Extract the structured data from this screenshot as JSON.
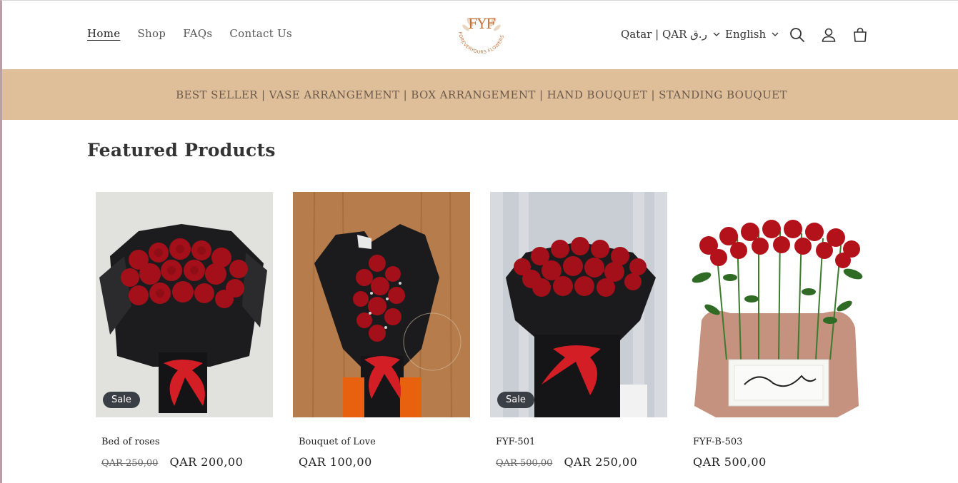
{
  "header": {
    "nav": [
      {
        "label": "Home",
        "active": true
      },
      {
        "label": "Shop",
        "active": false
      },
      {
        "label": "FAQs",
        "active": false
      },
      {
        "label": "Contact Us",
        "active": false
      }
    ],
    "logo_monogram": "FYF",
    "logo_text": "FOREVERYOURS FLOWERS",
    "country_currency": "Qatar | QAR ر.ق",
    "language": "English",
    "icons": [
      "search-icon",
      "account-icon",
      "cart-icon"
    ]
  },
  "banner": {
    "text": "BEST SELLER | VASE ARRANGEMENT | BOX ARRANGEMENT | HAND BOUQUET | STANDING BOUQUET"
  },
  "featured": {
    "title": "Featured Products",
    "products": [
      {
        "name": "Bed of roses",
        "old_price": "QAR 250,00",
        "price": "QAR 200,00",
        "badge": "Sale"
      },
      {
        "name": "Bouquet of Love",
        "old_price": "",
        "price": "QAR 100,00",
        "badge": ""
      },
      {
        "name": "FYF-501",
        "old_price": "QAR 500,00",
        "price": "QAR 250,00",
        "badge": "Sale"
      },
      {
        "name": "FYF-B-503",
        "old_price": "",
        "price": "QAR 500,00",
        "badge": ""
      }
    ]
  },
  "colors": {
    "banner_bg": "#dfbe9a",
    "logo_accent": "#c6703a",
    "badge_bg": "#3a3f45",
    "rose_red": "#b3121b"
  }
}
